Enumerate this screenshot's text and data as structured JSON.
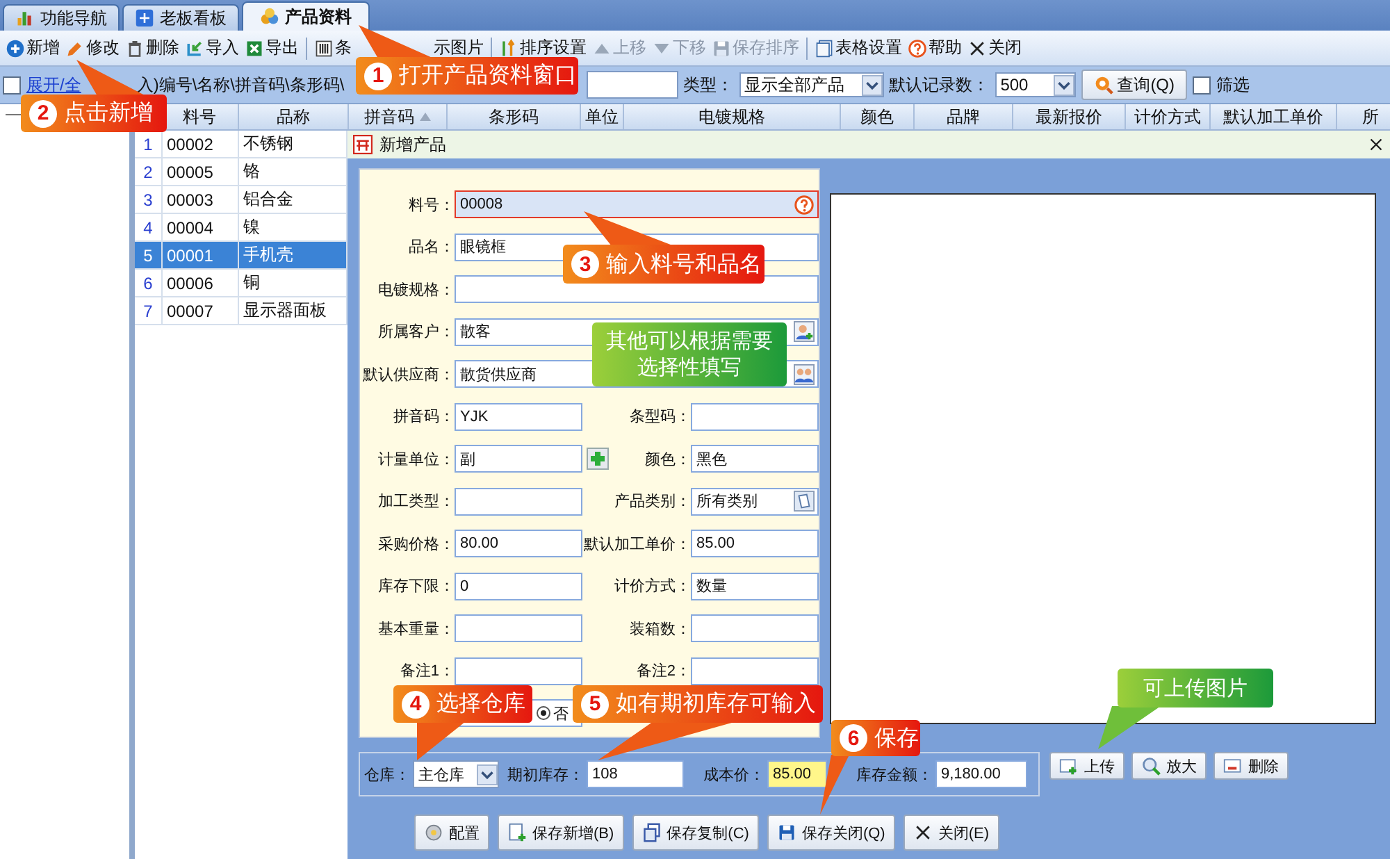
{
  "tabs": [
    {
      "label": "功能导航",
      "selected": false
    },
    {
      "label": "老板看板",
      "selected": false
    },
    {
      "label": "产品资料",
      "selected": true
    }
  ],
  "toolbar": [
    {
      "label": "新增",
      "disabled": false
    },
    {
      "label": "修改",
      "disabled": false
    },
    {
      "label": "删除",
      "disabled": false
    },
    {
      "label": "导入",
      "disabled": false
    },
    {
      "label": "导出",
      "disabled": false
    },
    {
      "label": "条",
      "disabled": false
    },
    {
      "label": "示图片",
      "disabled": false
    },
    {
      "label": "排序设置",
      "disabled": false
    },
    {
      "label": "上移",
      "disabled": true
    },
    {
      "label": "下移",
      "disabled": true
    },
    {
      "label": "保存排序",
      "disabled": true
    },
    {
      "label": "表格设置",
      "disabled": false
    },
    {
      "label": "帮助",
      "disabled": false
    },
    {
      "label": "关闭",
      "disabled": false
    }
  ],
  "filter": {
    "expand_checked": false,
    "expand_link": "展开/全",
    "hint": "入)编号\\名称\\拼音码\\条形码\\",
    "type_label": "类型：",
    "type_value": "显示全部产品",
    "count_label": "默认记录数：",
    "count_value": "500",
    "query_button": "查询(Q)",
    "filter_label": "筛选",
    "filter_checked": false
  },
  "table": {
    "columns": [
      {
        "label": "料号",
        "sorted": false
      },
      {
        "label": "品称",
        "sorted": false
      },
      {
        "label": "拼音码",
        "sorted": true
      },
      {
        "label": "条形码",
        "sorted": false
      },
      {
        "label": "单位",
        "sorted": false
      },
      {
        "label": "电镀规格",
        "sorted": false
      },
      {
        "label": "颜色",
        "sorted": false
      },
      {
        "label": "品牌",
        "sorted": false
      },
      {
        "label": "最新报价",
        "sorted": false
      },
      {
        "label": "计价方式",
        "sorted": false
      },
      {
        "label": "默认加工单价",
        "sorted": false
      },
      {
        "label": "所",
        "sorted": false
      }
    ],
    "rows": [
      {
        "index": "1",
        "code": "00002",
        "name": "不锈钢",
        "selected": false
      },
      {
        "index": "2",
        "code": "00005",
        "name": "铬",
        "selected": false
      },
      {
        "index": "3",
        "code": "00003",
        "name": "铝合金",
        "selected": false
      },
      {
        "index": "4",
        "code": "00004",
        "name": "镍",
        "selected": false
      },
      {
        "index": "5",
        "code": "00001",
        "name": "手机壳",
        "selected": true
      },
      {
        "index": "6",
        "code": "00006",
        "name": "铜",
        "selected": false
      },
      {
        "index": "7",
        "code": "00007",
        "name": "显示器面板",
        "selected": false
      }
    ]
  },
  "dialog": {
    "title": "新增产品",
    "form": [
      {
        "kind": "wide",
        "fields": [
          {
            "label": "料号：",
            "value": "00008",
            "invalid": true
          }
        ]
      },
      {
        "kind": "wide",
        "fields": [
          {
            "label": "品名：",
            "value": "眼镜框",
            "invalid": false
          }
        ]
      },
      {
        "kind": "wide",
        "fields": [
          {
            "label": "电镀规格：",
            "invalid": false
          }
        ]
      },
      {
        "kind": "wide",
        "fields": [
          {
            "label": "所属客户：",
            "value": "散客",
            "invalid": false
          }
        ]
      },
      {
        "kind": "wide",
        "fields": [
          {
            "label": "默认供应商：",
            "value": "散货供应商",
            "invalid": false
          }
        ]
      },
      {
        "kind": "pair",
        "fields": [
          {
            "label": "拼音码：",
            "value": "YJK",
            "invalid": false
          },
          {
            "label": "条型码：",
            "invalid": false
          }
        ]
      },
      {
        "kind": "pair",
        "fields": [
          {
            "label": "计量单位：",
            "value": "副",
            "invalid": false
          },
          {
            "label": "颜色：",
            "value": "黑色",
            "invalid": false
          }
        ]
      },
      {
        "kind": "pair",
        "fields": [
          {
            "label": "加工类型：",
            "invalid": false
          },
          {
            "label": "产品类别：",
            "value": "所有类别",
            "invalid": false
          }
        ]
      },
      {
        "kind": "pair",
        "fields": [
          {
            "label": "采购价格：",
            "value": "80.00",
            "invalid": false
          },
          {
            "label": "默认加工单价：",
            "value": "85.00",
            "invalid": false
          }
        ]
      },
      {
        "kind": "pair",
        "fields": [
          {
            "label": "库存下限：",
            "value": "0",
            "invalid": false
          },
          {
            "label": "计价方式：",
            "value": "数量",
            "invalid": false
          }
        ]
      },
      {
        "kind": "pair",
        "fields": [
          {
            "label": "基本重量：",
            "invalid": false
          },
          {
            "label": "装箱数：",
            "invalid": false
          }
        ]
      },
      {
        "kind": "pair",
        "fields": [
          {
            "label": "备注1：",
            "invalid": false
          },
          {
            "label": "备注2：",
            "invalid": false
          }
        ]
      },
      {
        "kind": "radio",
        "option": "否",
        "selected": true
      }
    ],
    "image_buttons": [
      "上传",
      "放大",
      "删除"
    ],
    "stock": [
      {
        "label": "仓库：",
        "value": "主仓库",
        "kind": "select",
        "focused": false
      },
      {
        "label": "期初库存：",
        "value": "108",
        "kind": "input",
        "focused": false
      },
      {
        "label": "成本价：",
        "value": "85.00",
        "kind": "input",
        "focused": true
      },
      {
        "label": "库存金额：",
        "value": "9,180.00",
        "kind": "input",
        "focused": false
      }
    ],
    "buttons": [
      "配置",
      "保存新增(B)",
      "保存复制(C)",
      "保存关闭(Q)",
      "关闭(E)"
    ]
  },
  "callouts": [
    {
      "kind": "step",
      "number": "1",
      "text": "打开产品资料窗口"
    },
    {
      "kind": "step",
      "number": "2",
      "text": "点击新增"
    },
    {
      "kind": "step",
      "number": "3",
      "text": "输入料号和品名"
    },
    {
      "kind": "hint",
      "text": "其他可以根据需要选择性填写"
    },
    {
      "kind": "step",
      "number": "4",
      "text": "选择仓库"
    },
    {
      "kind": "step",
      "number": "5",
      "text": "如有期初库存可输入"
    },
    {
      "kind": "step",
      "number": "6",
      "text": "保存"
    },
    {
      "kind": "hint",
      "text": "可上传图片"
    }
  ]
}
